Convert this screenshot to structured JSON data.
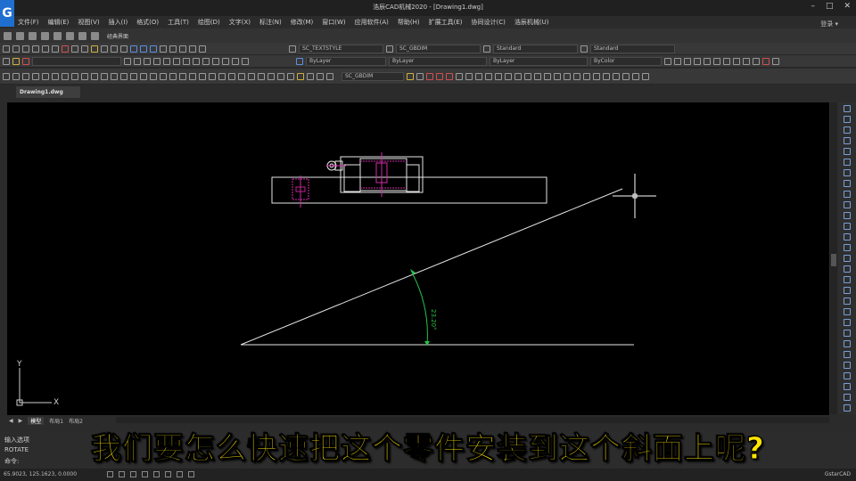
{
  "titlebar": {
    "logo": "G",
    "title": "浩辰CAD机械2020 - [Drawing1.dwg]",
    "user": "登录 ▾"
  },
  "menu": [
    "文件(F)",
    "编辑(E)",
    "视图(V)",
    "插入(I)",
    "格式(O)",
    "工具(T)",
    "绘图(D)",
    "文字(X)",
    "标注(N)",
    "修改(M)",
    "窗口(W)",
    "应用软件(A)",
    "帮助(H)",
    "扩展工具(E)",
    "协同设计(C)",
    "浩辰机械(U)"
  ],
  "quickbar": {
    "workspace": "经典界面"
  },
  "toolbar1": {
    "text_style": "SC_TEXTSTYLE",
    "dim_style": "SC_GBDIM",
    "table_style": "Standard",
    "mleader_style": "Standard"
  },
  "toolbar2": {
    "linetype": "ByLayer",
    "lineweight": "ByLayer",
    "color": "ByLayer",
    "plot_style": "ByColor"
  },
  "toolbar3": {
    "dim_combo": "SC_GBDIM"
  },
  "doc_tab": "Drawing1.dwg",
  "drawing": {
    "angle_label": "23.20°",
    "ucs_x": "X",
    "ucs_y": "Y"
  },
  "layout_tabs": [
    "模型",
    "布局1",
    "布局2"
  ],
  "command": {
    "line1": "输入选项",
    "line2": "ROTATE",
    "prompt": "命令:"
  },
  "status": {
    "coords": "65.9023, 125.1623, 0.0000",
    "right": "GstarCAD"
  },
  "subtitle": "我们要怎么快速把这个零件安装到这个斜面上呢?"
}
